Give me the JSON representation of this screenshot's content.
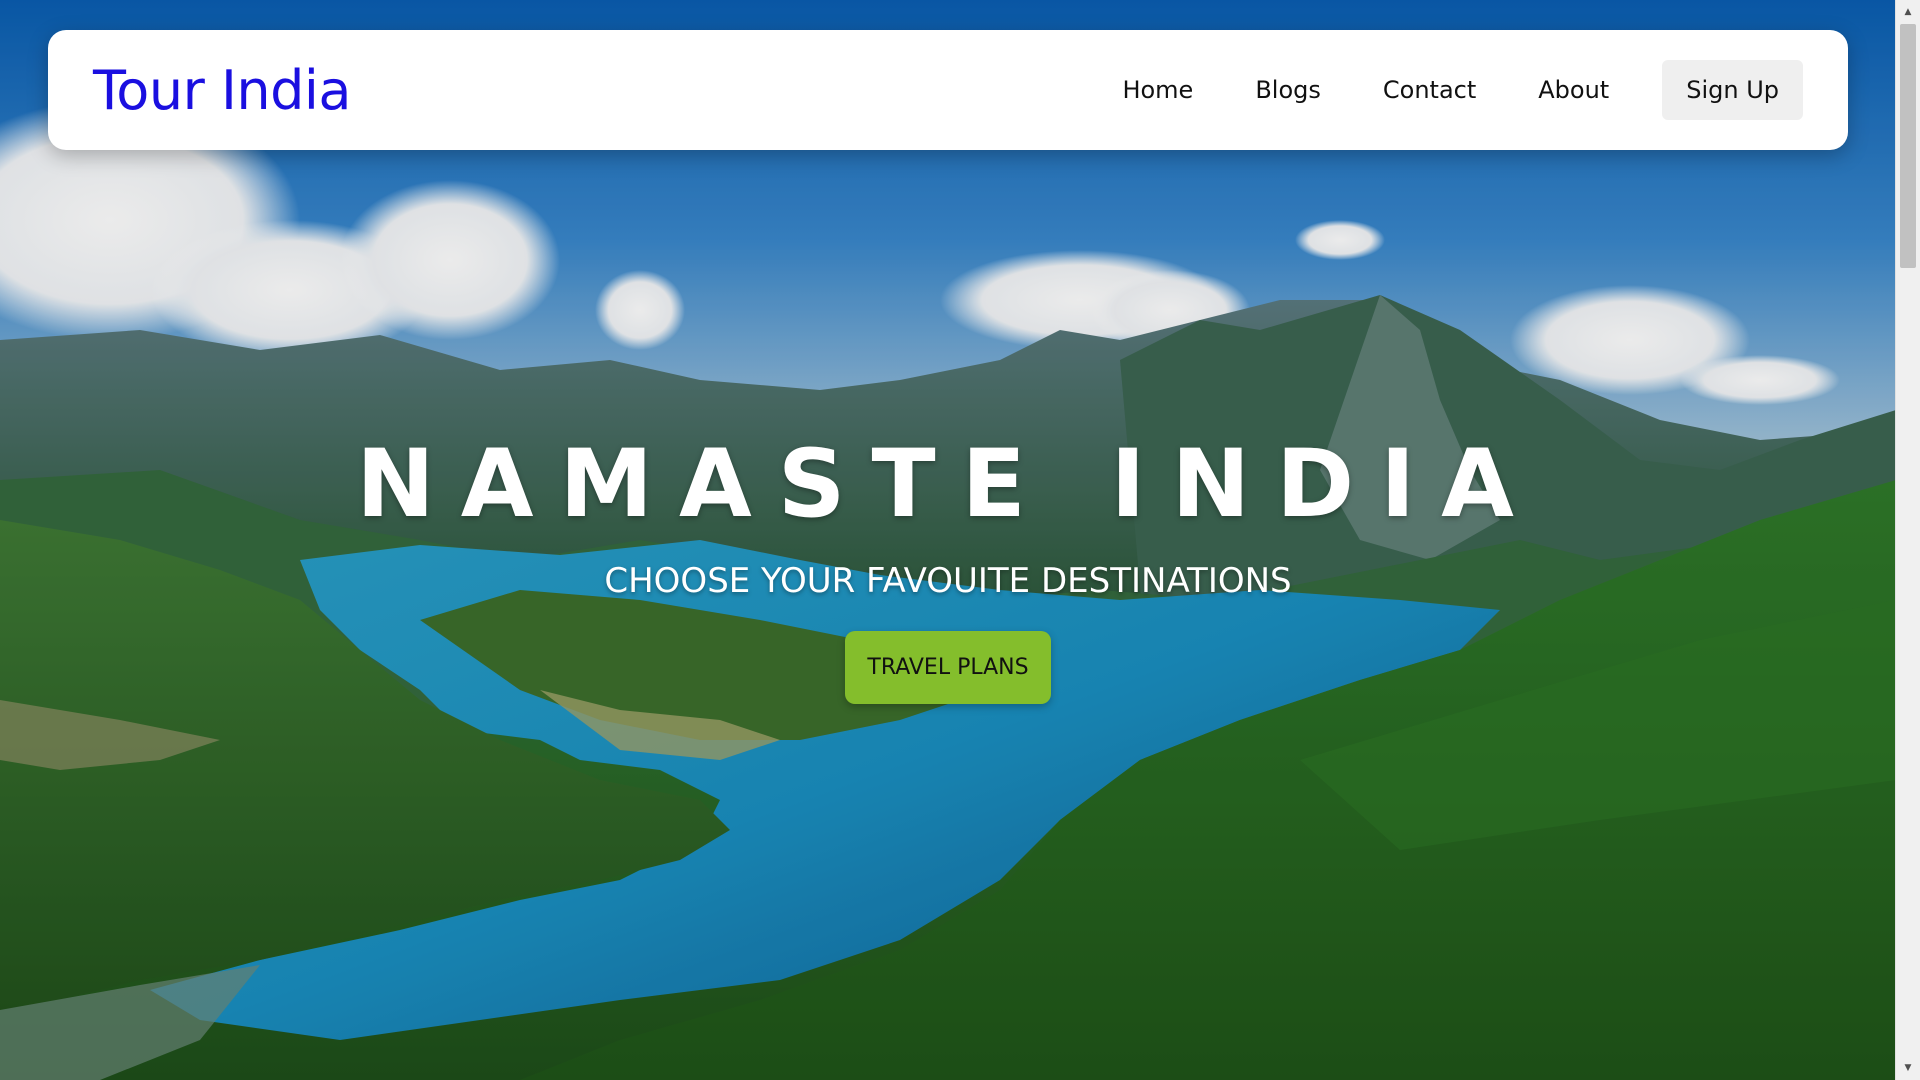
{
  "brand": {
    "logo": "Tour India",
    "logo_color": "#1a0fe0"
  },
  "nav": {
    "links": [
      "Home",
      "Blogs",
      "Contact",
      "About"
    ],
    "signup_label": "Sign Up"
  },
  "hero": {
    "title": "NAMASTE INDIA",
    "subtitle": "CHOOSE YOUR FAVOUITE DESTINATIONS",
    "cta_label": "TRAVEL PLANS",
    "cta_color": "#84be2c",
    "background": "aerial photo of mountains, lake and forest"
  },
  "icons": {
    "scroll_up": "triangle-up-icon",
    "scroll_down": "triangle-down-icon"
  }
}
